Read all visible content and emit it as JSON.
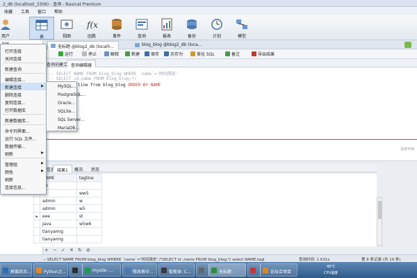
{
  "window": {
    "title": "2_db (localhost_3306) - 查询 - Navicat Premium"
  },
  "menubar": [
    "收藏",
    "工具",
    "窗口",
    "帮助"
  ],
  "ribbon": [
    {
      "label": "用户",
      "icon": "user-icon"
    },
    {
      "label": "表",
      "icon": "table-icon"
    },
    {
      "label": "视图",
      "icon": "view-icon"
    },
    {
      "label": "函数",
      "icon": "function-icon"
    },
    {
      "label": "事件",
      "icon": "event-icon"
    },
    {
      "label": "查询",
      "icon": "query-icon"
    },
    {
      "label": "报表",
      "icon": "report-icon"
    },
    {
      "label": "备份",
      "icon": "backup-icon"
    },
    {
      "label": "计划",
      "icon": "schedule-icon"
    },
    {
      "label": "模型",
      "icon": "model-icon"
    }
  ],
  "tree": {
    "root": "306"
  },
  "doc_tabs": [
    "无标题 @blog2_db (localh...",
    "blog_blog @blog2_db (loca..."
  ],
  "toolbar": {
    "run": "运行",
    "stop": "停止",
    "explain": "解释",
    "new": "新建",
    "save": "保存",
    "save_as": "另存为",
    "beautify": "美化 SQL",
    "snippet": "备注",
    "export": "导出结果"
  },
  "editor_tabs": [
    "查询创建工具",
    "查询编辑器"
  ],
  "editor": {
    "comment1": "-- SELECT  NAME FROM blog_blog WHERE  `name`='时间简史'",
    "comment2": "-- SELECT id,name FROM blog_blog;*/",
    "code_prefix": "line from blog_blog ",
    "code_kw": "ORDER BY NAME"
  },
  "side_note": "没有可用",
  "result_tabs": [
    "信息",
    "结果1",
    "概况",
    "状态"
  ],
  "grid": {
    "headers": [
      "NAME",
      "tagline"
    ],
    "rows": [
      [
        "44",
        ""
      ],
      [
        "",
        "ww5"
      ],
      [
        "admin",
        "w"
      ],
      [
        "admin",
        "w5"
      ],
      [
        "eee",
        "st"
      ],
      [
        "Java",
        "w5w6"
      ],
      [
        "tianyamig",
        ""
      ],
      [
        "tianyamig",
        ""
      ]
    ]
  },
  "status": {
    "query_text": "-- SELECT  NAME FROM blog_blog WHERE `name`='时间简史' /*SELECT id ,name FROM blog_blog;*/ select NAME,tagl",
    "query_time": "查询时间: 1.631s",
    "record": "第 8 条记录 (共 19 条)"
  },
  "context_menu": {
    "items": [
      "打开连接",
      "关闭连接",
      "新建查询",
      "编辑连接...",
      "新建连接",
      "删除连接",
      "复制连接...",
      "打开数据库",
      "新建数据库...",
      "命令列界面...",
      "运行 SQL 文件...",
      "数据传输...",
      "刷新",
      "管理组",
      "颜色",
      "刷新",
      "连接信息..."
    ]
  },
  "submenu": {
    "items": [
      "MySQL...",
      "PostgreSQL...",
      "Oracle...",
      "SQLite...",
      "SQL Server...",
      "MariaDB..."
    ]
  },
  "taskbar": {
    "items": [
      "屏幕后台...",
      "Python之...",
      "",
      "mysite -...",
      "修改表中...",
      "智能体: C...",
      "",
      "无标题 -",
      "",
      "论坛合项目"
    ],
    "tray_speed": "48°C",
    "tray_cpu": "CPU温度"
  },
  "colors": {
    "accent": "#3c6ea6",
    "highlight": "#cfe2f7",
    "redline": "#e03030"
  }
}
